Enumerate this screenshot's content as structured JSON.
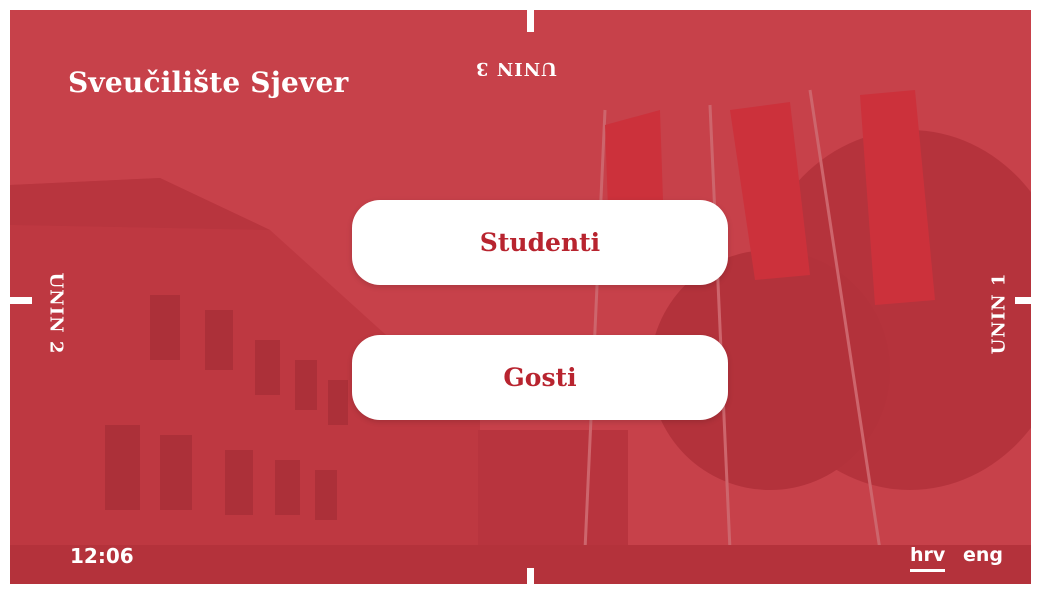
{
  "header": {
    "title": "Sveučilište Sjever"
  },
  "directions": {
    "top": "UNIN 3",
    "right": "UNIN 1",
    "left": "UNIN 2"
  },
  "menu": {
    "students_label": "Studenti",
    "guests_label": "Gosti"
  },
  "footer": {
    "time": "12:06",
    "languages": [
      {
        "code": "hrv",
        "active": true
      },
      {
        "code": "eng",
        "active": false
      }
    ]
  },
  "theme": {
    "accent": "#c8414a",
    "button_text": "#b8242f",
    "button_bg": "#ffffff"
  }
}
